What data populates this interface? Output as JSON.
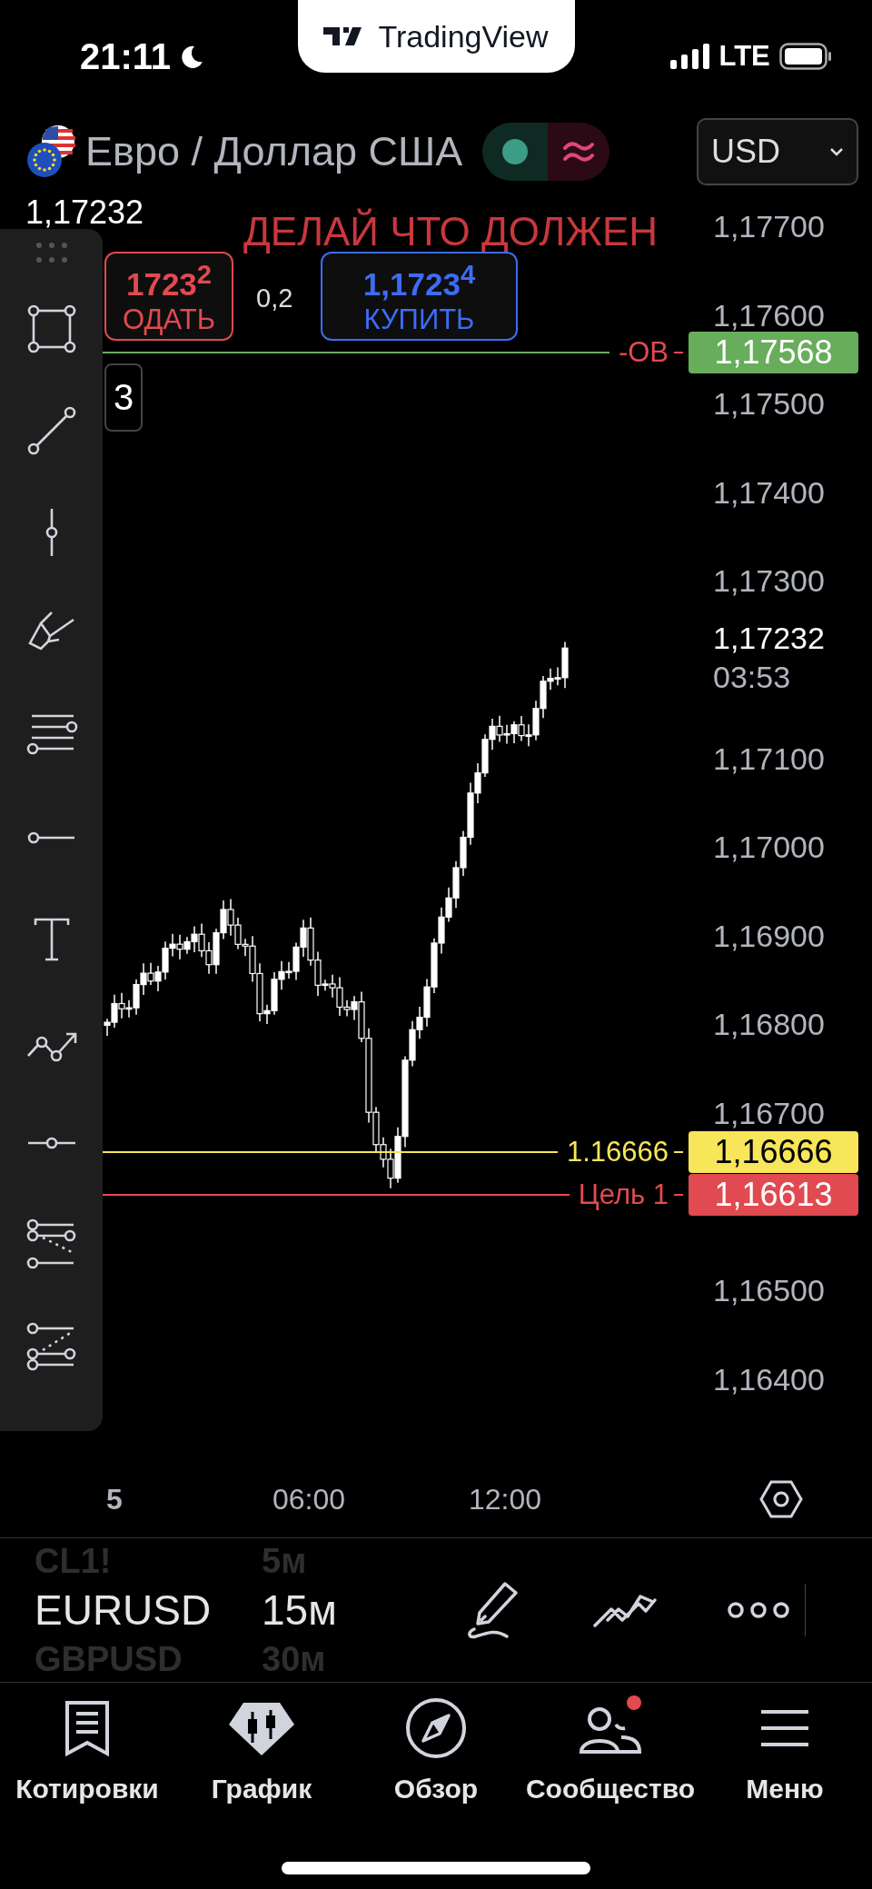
{
  "status_bar": {
    "time": "21:11",
    "network": "LTE"
  },
  "app_badge": {
    "name": "TradingView"
  },
  "header": {
    "title": "Евро / Доллар США",
    "currency": "USD"
  },
  "chart": {
    "last_price": "1,17232",
    "annotation": "ДЕЛАЙ ЧТО ДОЛЖЕН",
    "sell": {
      "price": "1723$^{2}$",
      "label": "ОДАТЬ"
    },
    "spread": "0,2",
    "buy": {
      "price": "1,1723$^{4}$",
      "label": "КУПИТЬ"
    },
    "counter": "3",
    "price_ticks": [
      "1,17700",
      "1,17600",
      "1,17500",
      "1,17400",
      "1,17300",
      "1,17100",
      "1,17000",
      "1,16900",
      "1,16800",
      "1,16700",
      "1,16500",
      "1,16400"
    ],
    "current": {
      "price": "1,17232",
      "countdown": "03:53"
    },
    "levels": [
      {
        "kind": "position",
        "label": "-ОВ",
        "price": "1,17568",
        "color": "#67ad5b"
      },
      {
        "kind": "drawing",
        "label": "1.16666",
        "price": "1,16666",
        "color": "#f7e55a"
      },
      {
        "kind": "drawing",
        "label": "Цель 1",
        "price": "1,16613",
        "color": "#e04a50"
      }
    ],
    "time_ticks": [
      {
        "kind": "day",
        "label": "5"
      },
      {
        "kind": "time",
        "label": "06:00"
      },
      {
        "kind": "time",
        "label": "12:00"
      }
    ]
  },
  "symbol_bar": {
    "symbols": [
      {
        "name": "CL1!",
        "selected": false
      },
      {
        "name": "EURUSD",
        "selected": true
      },
      {
        "name": "GBPUSD",
        "selected": false
      }
    ],
    "intervals": [
      {
        "label": "5м",
        "selected": false
      },
      {
        "label": "15м",
        "selected": true
      },
      {
        "label": "30м",
        "selected": false
      }
    ]
  },
  "nav": [
    {
      "label": "Котировки",
      "notification": false
    },
    {
      "label": "График",
      "notification": false
    },
    {
      "label": "Обзор",
      "notification": false
    },
    {
      "label": "Сообщество",
      "notification": true
    },
    {
      "label": "Меню",
      "notification": false
    }
  ]
}
